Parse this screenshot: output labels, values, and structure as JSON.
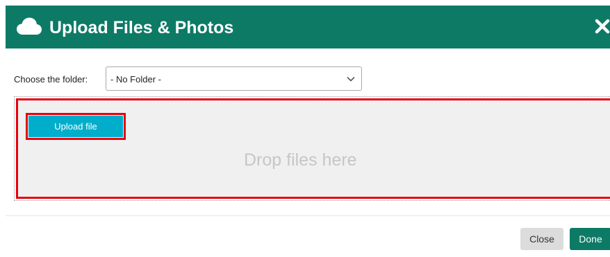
{
  "header": {
    "title": "Upload Files & Photos",
    "icon": "cloud-icon",
    "close_icon": "close-icon"
  },
  "folder": {
    "label": "Choose the folder:",
    "selected": "- No Folder -",
    "icon": "chevron-down-icon"
  },
  "dropzone": {
    "upload_label": "Upload file",
    "drop_text": "Drop files here"
  },
  "footer": {
    "close_label": "Close",
    "done_label": "Done"
  },
  "colors": {
    "brand": "#0d7a66",
    "upload_button": "#00aecb",
    "highlight": "#e8000d",
    "dropzone_bg": "#f0f0f0",
    "close_button": "#dcdcdc"
  }
}
